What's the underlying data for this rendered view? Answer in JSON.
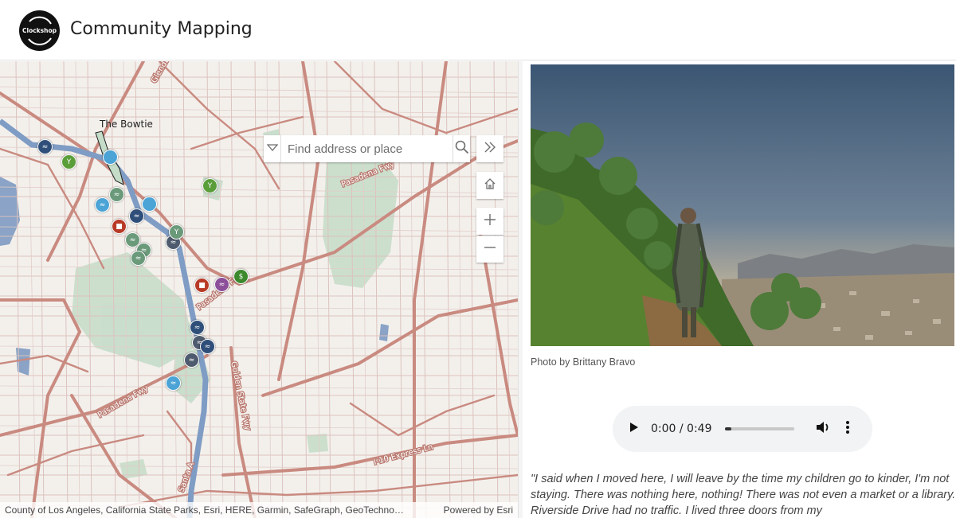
{
  "header": {
    "logo_text": "Clockshop",
    "title": "Community Mapping"
  },
  "map": {
    "search_placeholder": "Find address or place",
    "place_label": "The Bowtie",
    "attribution": "County of Los Angeles, California State Parks, Esri, HERE, Garmin, SafeGraph, GeoTechno…",
    "powered_by": "Powered by Esri",
    "icons": {
      "dropdown": "chevron-down-icon",
      "search": "search-icon",
      "collapse": "double-chevron-right-icon",
      "home": "home-icon",
      "zoom_in": "plus-icon",
      "zoom_out": "minus-icon"
    },
    "marker_colors": {
      "navy": "#2f4f7a",
      "light_blue": "#4ba3d6",
      "green": "#5a9e3a",
      "gray_green": "#6a9a7a",
      "red": "#b83a26",
      "purple": "#8c4f9a",
      "slate": "#4e5b6e",
      "dark_green": "#3d8a2e"
    },
    "markers": [
      {
        "color": "navy",
        "glyph": "≈"
      },
      {
        "color": "green",
        "glyph": "Y"
      },
      {
        "color": "light_blue",
        "glyph": ""
      },
      {
        "color": "gray_green",
        "glyph": "≈"
      },
      {
        "color": "light_blue",
        "glyph": "≈"
      },
      {
        "color": "navy",
        "glyph": "≈"
      },
      {
        "color": "light_blue",
        "glyph": ""
      },
      {
        "color": "red",
        "glyph": "■"
      },
      {
        "color": "gray_green",
        "glyph": "≈"
      },
      {
        "color": "gray_green",
        "glyph": "≈"
      },
      {
        "color": "slate",
        "glyph": "≈"
      },
      {
        "color": "gray_green",
        "glyph": "≈"
      },
      {
        "color": "gray_green",
        "glyph": "Y"
      },
      {
        "color": "green",
        "glyph": "Y"
      },
      {
        "color": "red",
        "glyph": "■"
      },
      {
        "color": "purple",
        "glyph": "≈"
      },
      {
        "color": "dark_green",
        "glyph": "$"
      },
      {
        "color": "navy",
        "glyph": "≈"
      },
      {
        "color": "slate",
        "glyph": "≈"
      },
      {
        "color": "navy",
        "glyph": "≈"
      },
      {
        "color": "slate",
        "glyph": "≈"
      },
      {
        "color": "light_blue",
        "glyph": "≈"
      }
    ]
  },
  "story": {
    "photo_caption": "Photo by Brittany Bravo",
    "audio": {
      "time": "0:00 / 0:49",
      "progress": 0.1
    },
    "quote": "\"I said when I moved here, I will leave by the time my children go to kinder, I'm not staying. There was nothing here, nothing! There was not even a market or a library. Riverside Drive had no traffic. I lived three doors from my"
  },
  "colors": {
    "road": "#c98a80",
    "river": "#7f9cc4",
    "park": "#c4dcc8"
  }
}
